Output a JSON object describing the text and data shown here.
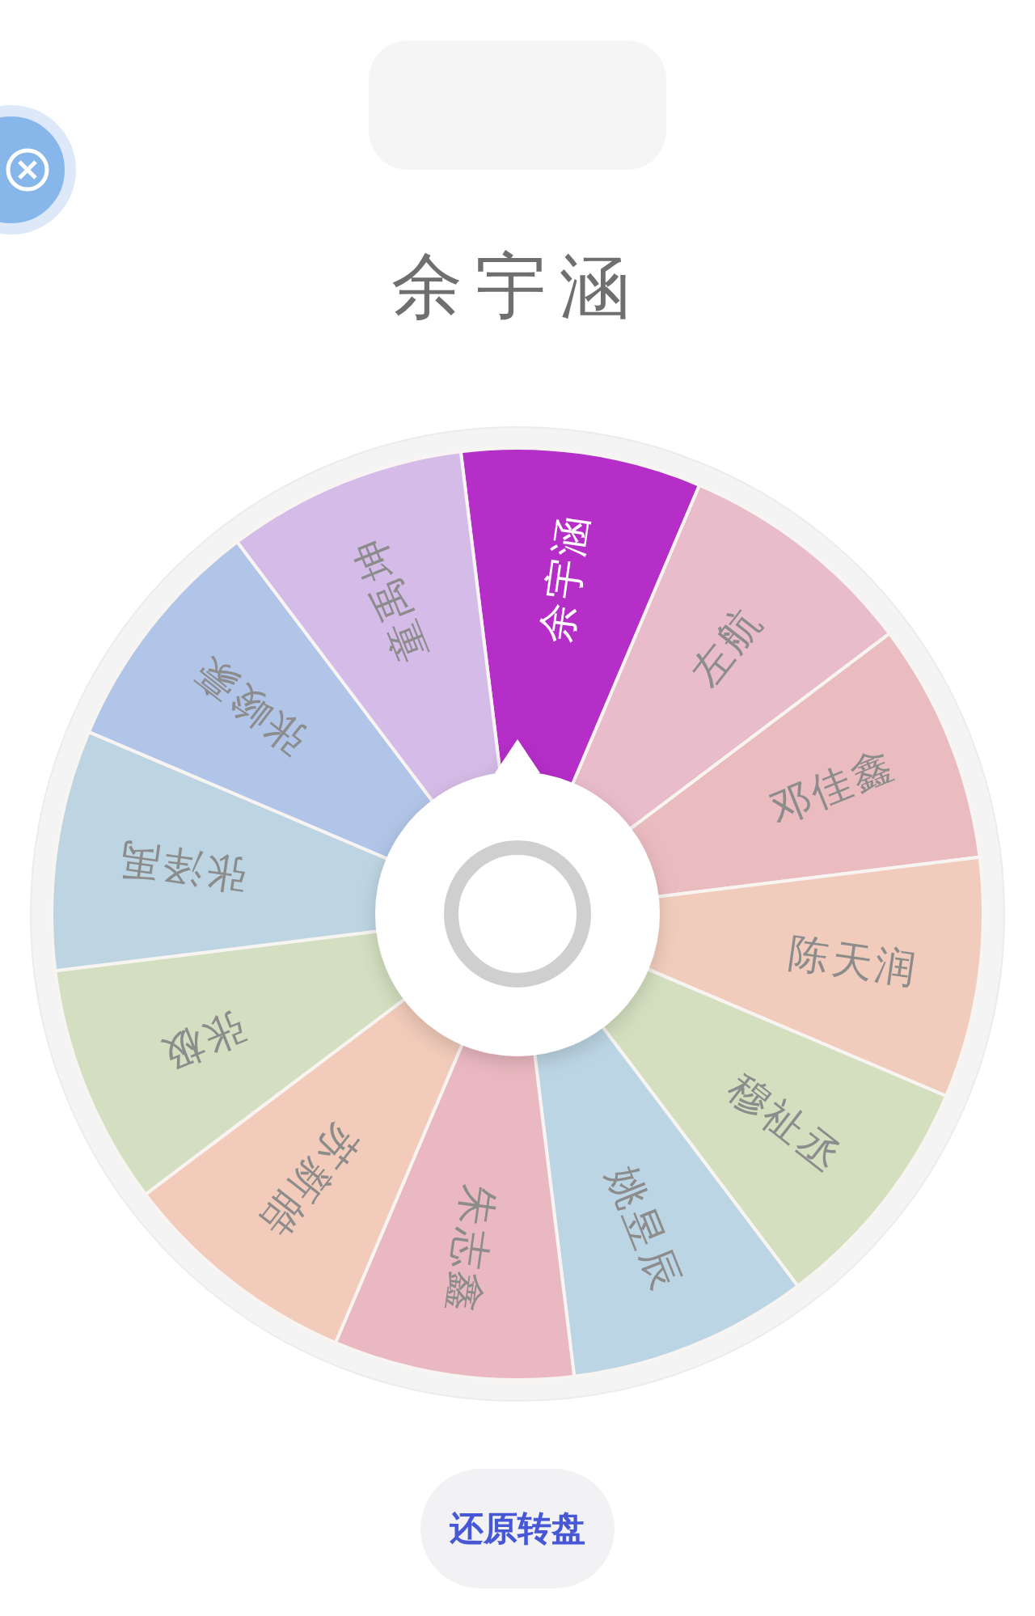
{
  "result": "余宇涵",
  "wheel": {
    "segments": [
      {
        "name": "余宇涵",
        "color": "#b52ec8",
        "selected": true
      },
      {
        "name": "左航",
        "color": "#e9bccb",
        "selected": false
      },
      {
        "name": "邓佳鑫",
        "color": "#ebbcbf",
        "selected": false
      },
      {
        "name": "陈天润",
        "color": "#f1ccbd",
        "selected": false
      },
      {
        "name": "穆祉丞",
        "color": "#d4dfc0",
        "selected": false
      },
      {
        "name": "姚昱辰",
        "color": "#bcd5e4",
        "selected": false
      },
      {
        "name": "朱志鑫",
        "color": "#eab8c0",
        "selected": false
      },
      {
        "name": "苏新皓",
        "color": "#f2cbba",
        "selected": false
      },
      {
        "name": "张极",
        "color": "#d3dfc0",
        "selected": false
      },
      {
        "name": "张泽禹",
        "color": "#bdd5e2",
        "selected": false
      },
      {
        "name": "张峻豪",
        "color": "#b1c5e8",
        "selected": false
      },
      {
        "name": "童禹坤",
        "color": "#d5bce8",
        "selected": false
      }
    ]
  },
  "reset_button": "还原转盘"
}
